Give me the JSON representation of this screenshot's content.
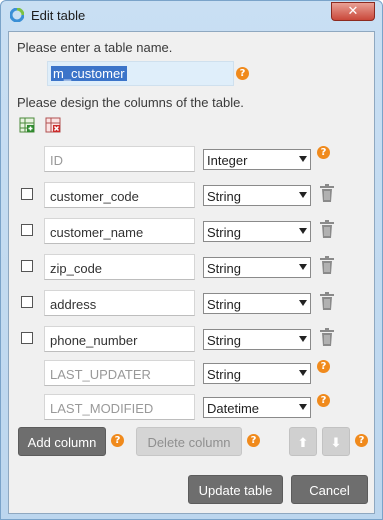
{
  "window": {
    "title": "Edit table",
    "close_glyph": "✕",
    "app_icon": "app-logo-icon"
  },
  "table_name": {
    "prompt": "Please enter a table name.",
    "value": "m_customer"
  },
  "columns_section": {
    "prompt": "Please design the columns of the table.",
    "toolbar_icons": [
      "import-columns-icon",
      "clear-columns-icon"
    ]
  },
  "columns": [
    {
      "name": "ID",
      "type": "Integer",
      "readonly": true,
      "checkbox": false,
      "trash": false,
      "help": true
    },
    {
      "name": "customer_code",
      "type": "String",
      "readonly": false,
      "checkbox": true,
      "trash": true,
      "help": false
    },
    {
      "name": "customer_name",
      "type": "String",
      "readonly": false,
      "checkbox": true,
      "trash": true,
      "help": false
    },
    {
      "name": "zip_code",
      "type": "String",
      "readonly": false,
      "checkbox": true,
      "trash": true,
      "help": false
    },
    {
      "name": "address",
      "type": "String",
      "readonly": false,
      "checkbox": true,
      "trash": true,
      "help": false
    },
    {
      "name": "phone_number",
      "type": "String",
      "readonly": false,
      "checkbox": true,
      "trash": true,
      "help": false
    },
    {
      "name": "LAST_UPDATER",
      "type": "String",
      "readonly": true,
      "checkbox": false,
      "trash": false,
      "help": true
    },
    {
      "name": "LAST_MODIFIED",
      "type": "Datetime",
      "readonly": true,
      "checkbox": false,
      "trash": false,
      "help": true
    }
  ],
  "buttons": {
    "add_column": "Add column",
    "delete_column": "Delete column",
    "move_up": "⬆",
    "move_down": "⬇",
    "update_table": "Update table",
    "cancel": "Cancel"
  },
  "help_glyph": "?",
  "colors": {
    "accent_help": "#f08a1c",
    "selection": "#3b74c9",
    "button_dark": "#6e6e6e"
  }
}
